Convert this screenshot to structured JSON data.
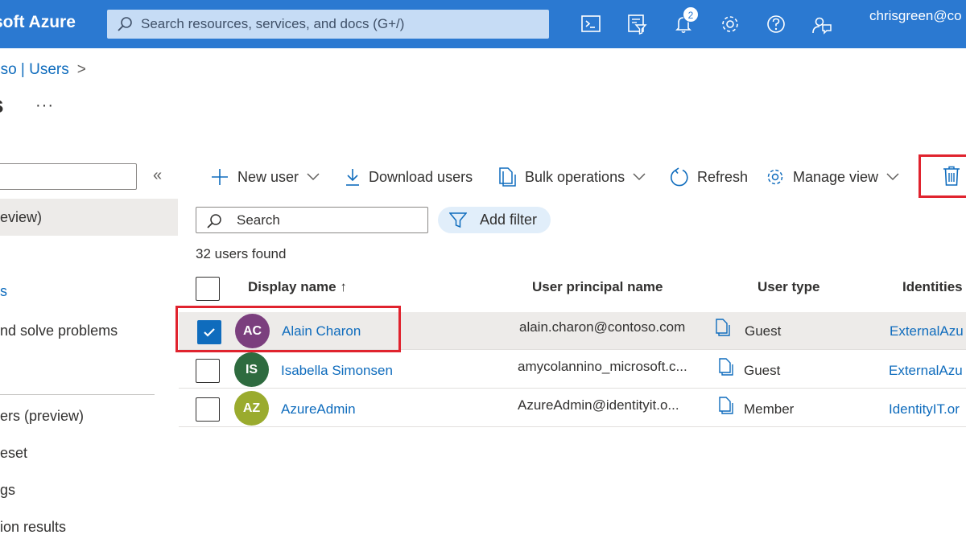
{
  "topbar": {
    "brand": "soft Azure",
    "search_placeholder": "Search resources, services, and docs (G+/)",
    "notification_count": "2",
    "account": "chrisgreen@co"
  },
  "breadcrumb": {
    "parent": "oso | Users",
    "separator": ">"
  },
  "page": {
    "title": "s",
    "more": "···"
  },
  "nav": {
    "collapse": "«",
    "items": [
      "eview)",
      "s",
      "nd solve problems",
      "ers (preview)",
      "eset",
      "gs",
      "ion results"
    ]
  },
  "commands": {
    "new_user": "New user",
    "download_users": "Download users",
    "bulk_operations": "Bulk operations",
    "refresh": "Refresh",
    "manage_view": "Manage view"
  },
  "filters": {
    "search_placeholder": "Search",
    "add_filter": "Add filter",
    "count": "32 users found"
  },
  "table": {
    "headers": {
      "display_name": "Display name ↑",
      "upn": "User principal name",
      "user_type": "User type",
      "identities": "Identities"
    },
    "rows": [
      {
        "initials": "AC",
        "name": "Alain Charon",
        "upn": "alain.charon@contoso.com",
        "type": "Guest",
        "identity": "ExternalAzu",
        "avatar_color": "#7b3f7e",
        "selected": true
      },
      {
        "initials": "IS",
        "name": "Isabella Simonsen",
        "upn": "amycolannino_microsoft.c...",
        "type": "Guest",
        "identity": "ExternalAzu",
        "avatar_color": "#2e6b3f",
        "selected": false
      },
      {
        "initials": "AZ",
        "name": "AzureAdmin",
        "upn": "AzureAdmin@identityit.o...",
        "type": "Member",
        "identity": "IdentityIT.or",
        "avatar_color": "#9aab2e",
        "selected": false
      }
    ]
  },
  "colors": {
    "topbar": "#2b79d1",
    "link": "#0f6cbd",
    "highlight": "#e0232e"
  }
}
